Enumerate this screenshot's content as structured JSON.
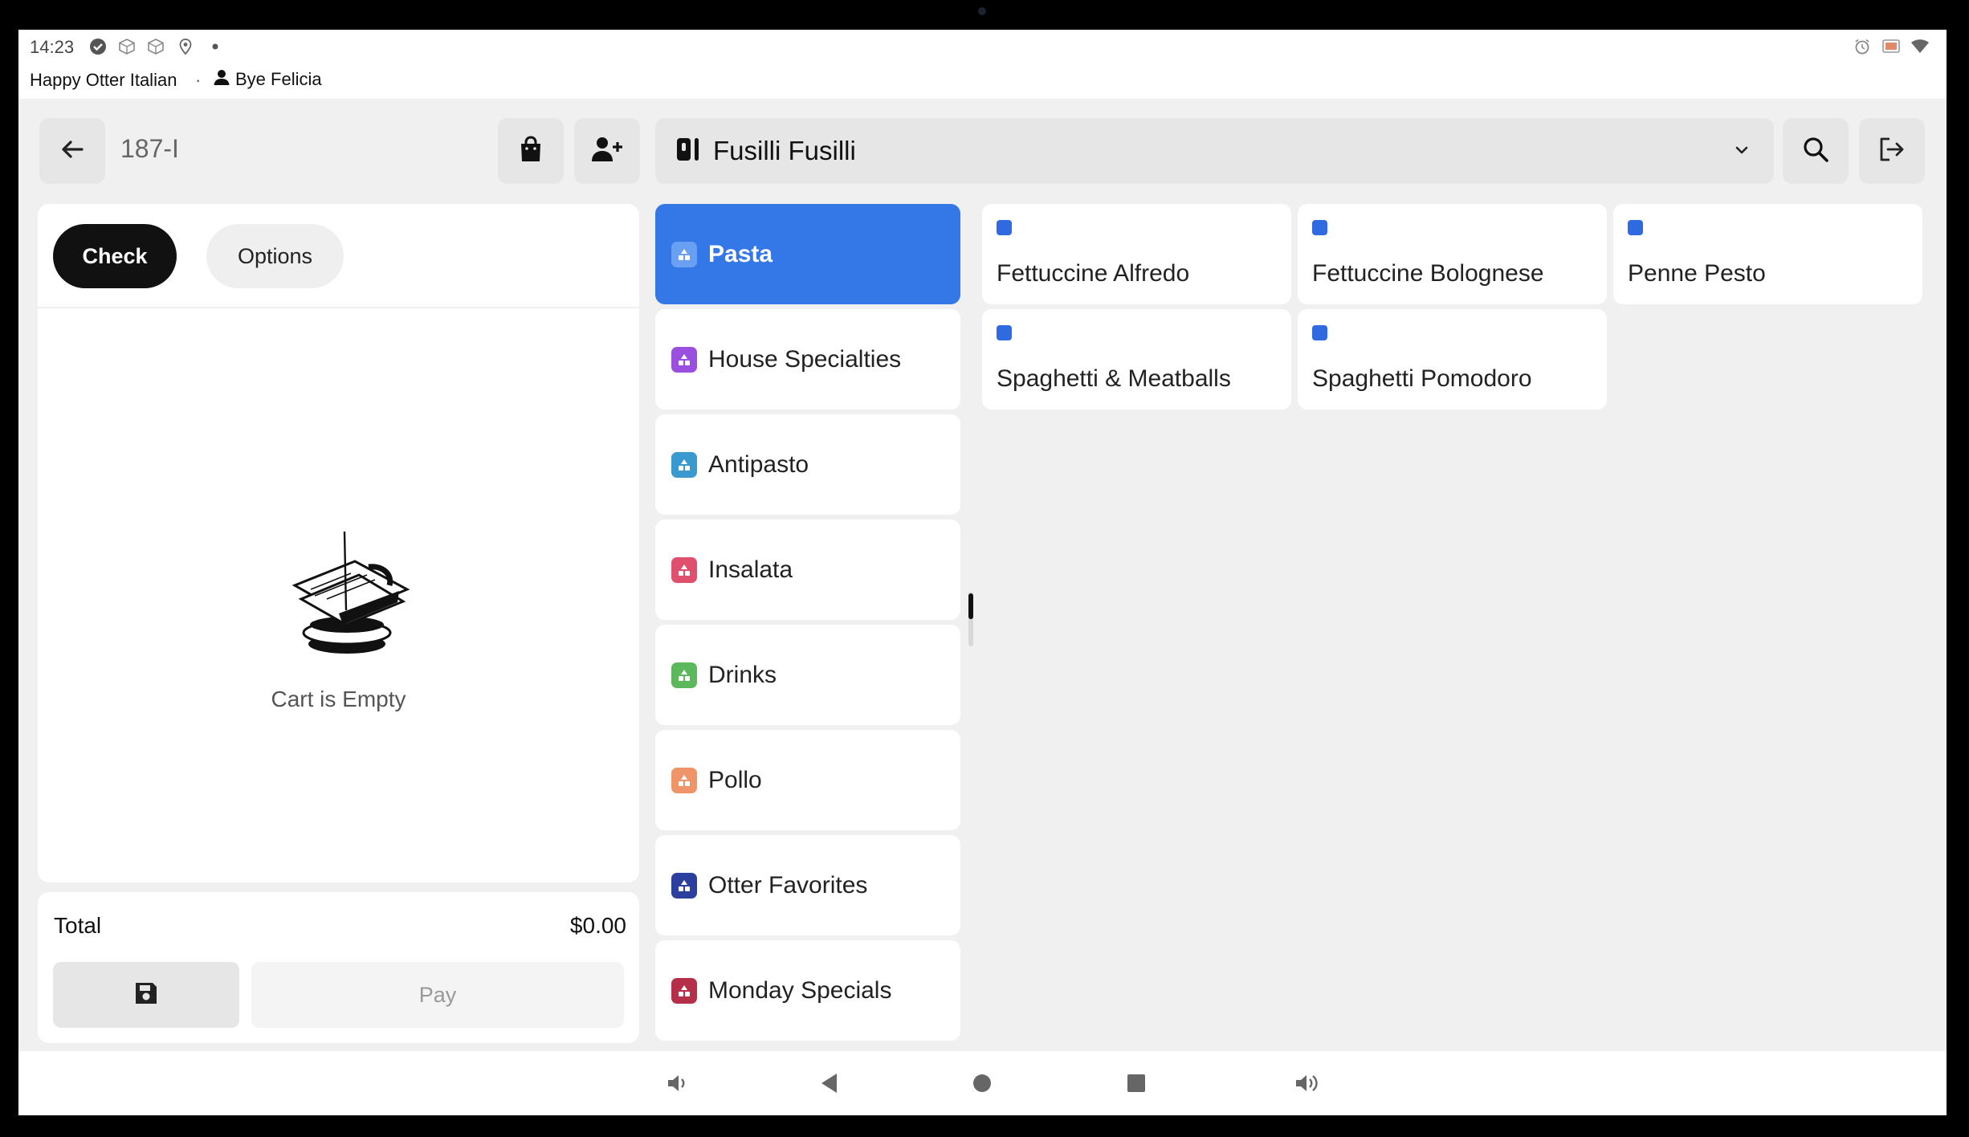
{
  "status_bar": {
    "time": "14:23",
    "store_name": "Happy Otter Italian",
    "separator": "·",
    "user_name": "Bye Felicia",
    "left_icons": [
      "check-circle-icon",
      "box-icon",
      "box-icon",
      "location-pin-icon",
      "dot-icon"
    ],
    "right_icons": [
      "alarm-icon",
      "cast-icon",
      "wifi-icon"
    ]
  },
  "header": {
    "order_id": "187-I",
    "menu_name": "Fusilli Fusilli"
  },
  "cart": {
    "tabs": [
      {
        "label": "Check",
        "active": true
      },
      {
        "label": "Options",
        "active": false
      }
    ],
    "empty_message": "Cart is Empty",
    "total_label": "Total",
    "total_value": "$0.00",
    "pay_label": "Pay"
  },
  "categories": [
    {
      "label": "Pasta",
      "color": "#3478e8",
      "active": true
    },
    {
      "label": "House Specialties",
      "color": "#9b4fe0",
      "active": false
    },
    {
      "label": "Antipasto",
      "color": "#3a9ad0",
      "active": false
    },
    {
      "label": "Insalata",
      "color": "#e0506e",
      "active": false
    },
    {
      "label": "Drinks",
      "color": "#5cb85c",
      "active": false
    },
    {
      "label": "Pollo",
      "color": "#f0946a",
      "active": false
    },
    {
      "label": "Otter Favorites",
      "color": "#2a3f9e",
      "active": false
    },
    {
      "label": "Monday Specials",
      "color": "#b52f4a",
      "active": false
    }
  ],
  "items": [
    {
      "label": "Fettuccine Alfredo"
    },
    {
      "label": "Fettuccine Bolognese"
    },
    {
      "label": "Penne Pesto"
    },
    {
      "label": "Spaghetti & Meatballs"
    },
    {
      "label": "Spaghetti Pomodoro"
    }
  ],
  "colors": {
    "accent": "#3478e8",
    "item_marker": "#2f6ae0",
    "primary_button": "#111111"
  },
  "navbar_icons": [
    "volume-down-icon",
    "back-icon",
    "home-icon",
    "recents-icon",
    "volume-up-icon"
  ]
}
